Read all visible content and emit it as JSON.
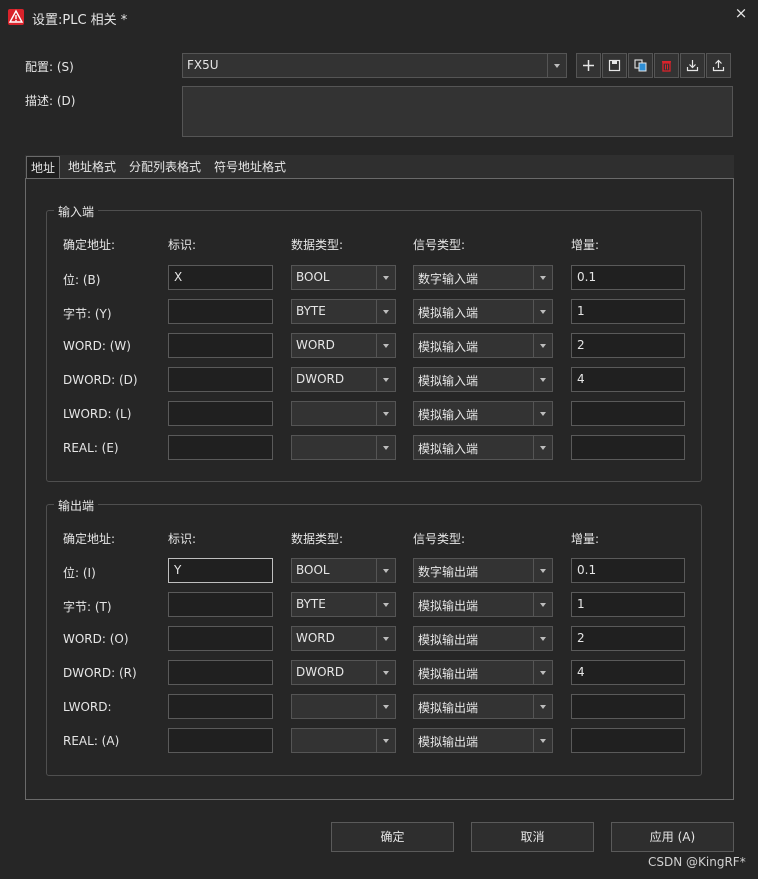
{
  "window": {
    "title": "设置:PLC 相关 *",
    "close": "×"
  },
  "config": {
    "label": "配置: (S)",
    "value": "FX5U"
  },
  "description": {
    "label": "描述: (D)",
    "value": ""
  },
  "toolbar": {
    "icons": [
      "add-icon",
      "save-icon",
      "copy-icon",
      "delete-icon",
      "import-icon",
      "export-icon"
    ]
  },
  "tabs": [
    "地址",
    "地址格式",
    "分配列表格式",
    "符号地址格式"
  ],
  "columns": [
    "确定地址:",
    "标识:",
    "数据类型:",
    "信号类型:",
    "增量:"
  ],
  "input_group": {
    "title": "输入端",
    "rows": [
      {
        "addr": "位: (B)",
        "id": "X",
        "dtype": "BOOL",
        "signal": "数字输入端",
        "inc": "0.1"
      },
      {
        "addr": "字节: (Y)",
        "id": "",
        "dtype": "BYTE",
        "signal": "模拟输入端",
        "inc": "1"
      },
      {
        "addr": "WORD: (W)",
        "id": "",
        "dtype": "WORD",
        "signal": "模拟输入端",
        "inc": "2"
      },
      {
        "addr": "DWORD: (D)",
        "id": "",
        "dtype": "DWORD",
        "signal": "模拟输入端",
        "inc": "4"
      },
      {
        "addr": "LWORD: (L)",
        "id": "",
        "dtype": "",
        "signal": "模拟输入端",
        "inc": ""
      },
      {
        "addr": "REAL: (E)",
        "id": "",
        "dtype": "",
        "signal": "模拟输入端",
        "inc": ""
      }
    ]
  },
  "output_group": {
    "title": "输出端",
    "rows": [
      {
        "addr": "位: (I)",
        "id": "Y",
        "dtype": "BOOL",
        "signal": "数字输出端",
        "inc": "0.1"
      },
      {
        "addr": "字节: (T)",
        "id": "",
        "dtype": "BYTE",
        "signal": "模拟输出端",
        "inc": "1"
      },
      {
        "addr": "WORD: (O)",
        "id": "",
        "dtype": "WORD",
        "signal": "模拟输出端",
        "inc": "2"
      },
      {
        "addr": "DWORD: (R)",
        "id": "",
        "dtype": "DWORD",
        "signal": "模拟输出端",
        "inc": "4"
      },
      {
        "addr": "LWORD:",
        "id": "",
        "dtype": "",
        "signal": "模拟输出端",
        "inc": ""
      },
      {
        "addr": "REAL: (A)",
        "id": "",
        "dtype": "",
        "signal": "模拟输出端",
        "inc": ""
      }
    ]
  },
  "buttons": {
    "ok": "确定",
    "cancel": "取消",
    "apply": "应用 (A)"
  },
  "watermark": "CSDN @KingRF*"
}
